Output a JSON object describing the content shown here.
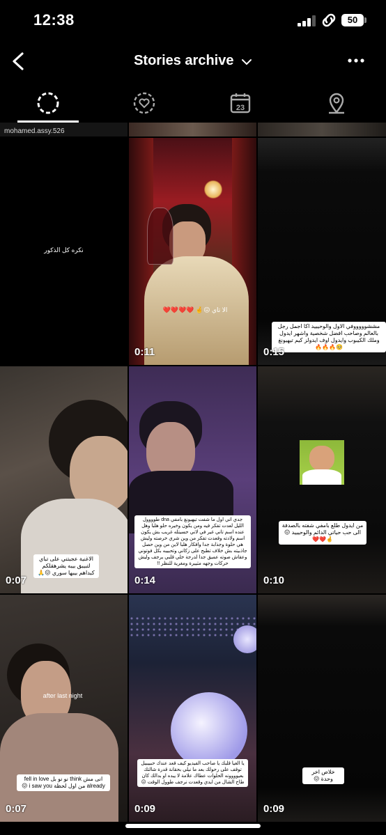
{
  "status_bar": {
    "time": "12:38",
    "battery": "50"
  },
  "header": {
    "title": "Stories archive"
  },
  "tabs": [
    "stories",
    "highlights",
    "calendar",
    "map"
  ],
  "grid": {
    "top_row_label": "mohamed.assy.526",
    "cells": [
      {
        "duration": "",
        "caption": "نكره كل الذكور"
      },
      {
        "duration": "0:11",
        "caption": "الا تاي 😖🤞 ❤️❤️❤️❤️"
      },
      {
        "duration": "0:15",
        "caption": "مششوووووفي الاول والوحيييد اكا اجمل رجل بالعالم وصاحب افضل شخصية واشهر ايدول وملك الكيبوب وايدول اوف ايدولز كيم تيهيونغ 🥺🔥🔥🔥"
      },
      {
        "duration": "0:07",
        "caption": "الاغنية عجبتني على تباي لتبيبق بيبه يشرهقلكم كبداهم بيبها سوري 😖🙏"
      },
      {
        "duration": "0:14",
        "caption": "جدي اني اول ما شفت تيهيونغ بامفي dna طوووول الليل لعدت تفكر فيه ومن يكون وخيره حلو هلبا وهل عنده اسم تاني غير في لاني حسيتله غريب بش يكون اسم ولادته وقعدت تفكر من وين شري خرصته وليش هي حلوة وجذابة جدا وافكار هلبا لاين من وين حصل جاذبيته بش خلاف تطبح على زكاني وتحبيبه بكل فوتوني وعقاش صوته عميق جدا لدرجة خلي قلبي يرجف وليش حركات وجهه مثييرة ومغرية للنظر !!"
      },
      {
        "duration": "0:10",
        "caption": "من ايدول طلع بامفي شفته بالصدفة الى حب حياتي الدائم والوحيييد 😖🤞❤️❤️"
      },
      {
        "duration": "0:07",
        "caption": "انى مش think نو نو بل fell in love already من اول لحظة i saw you 😖",
        "caption2": "after last night"
      },
      {
        "duration": "0:09",
        "caption": "يا الغيا قلبك يا صاحب الفيديو كيف قعد عندك حبييبيل توقف على رحولك بعد ما نيلي بحقانة قدرة شالتك بعيوووونه الحلوات عطاك علامة لا يبده او بدالك كان طاح الشال من ايدي وقعدت نرجف طوول الوقت 😖"
      },
      {
        "duration": "0:09",
        "caption": "خلاص اخر وحدة 😖"
      }
    ]
  }
}
